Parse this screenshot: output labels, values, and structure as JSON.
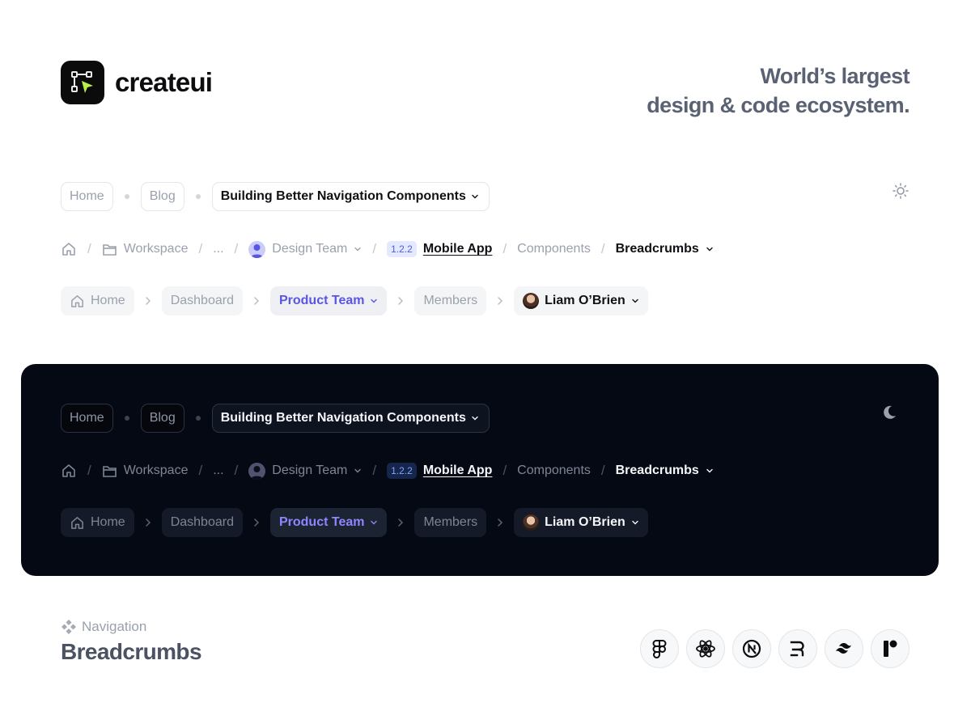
{
  "brand": {
    "name": "createui"
  },
  "tagline": {
    "line1": "World’s largest",
    "line2": "design & code ecosystem."
  },
  "breadcrumbs": {
    "pills": [
      "Home",
      "Blog"
    ],
    "pill_current": "Building Better Navigation Components",
    "slash": {
      "workspace": "Workspace",
      "ellipsis": "...",
      "team": "Design Team",
      "version": "1.2.2",
      "app": "Mobile App",
      "components": "Components",
      "current": "Breadcrumbs"
    },
    "chips": {
      "home": "Home",
      "dashboard": "Dashboard",
      "active": "Product Team",
      "members": "Members",
      "user": "Liam O’Brien"
    }
  },
  "footer": {
    "category": "Navigation",
    "title": "Breadcrumbs",
    "tech_icons": [
      "figma-icon",
      "react-icon",
      "nextjs-icon",
      "remix-icon",
      "tailwind-icon",
      "framer-icon"
    ]
  },
  "colors": {
    "accent": "#5b55e6",
    "dark_panel": "#050913",
    "version_badge": "#e4e9ff"
  }
}
